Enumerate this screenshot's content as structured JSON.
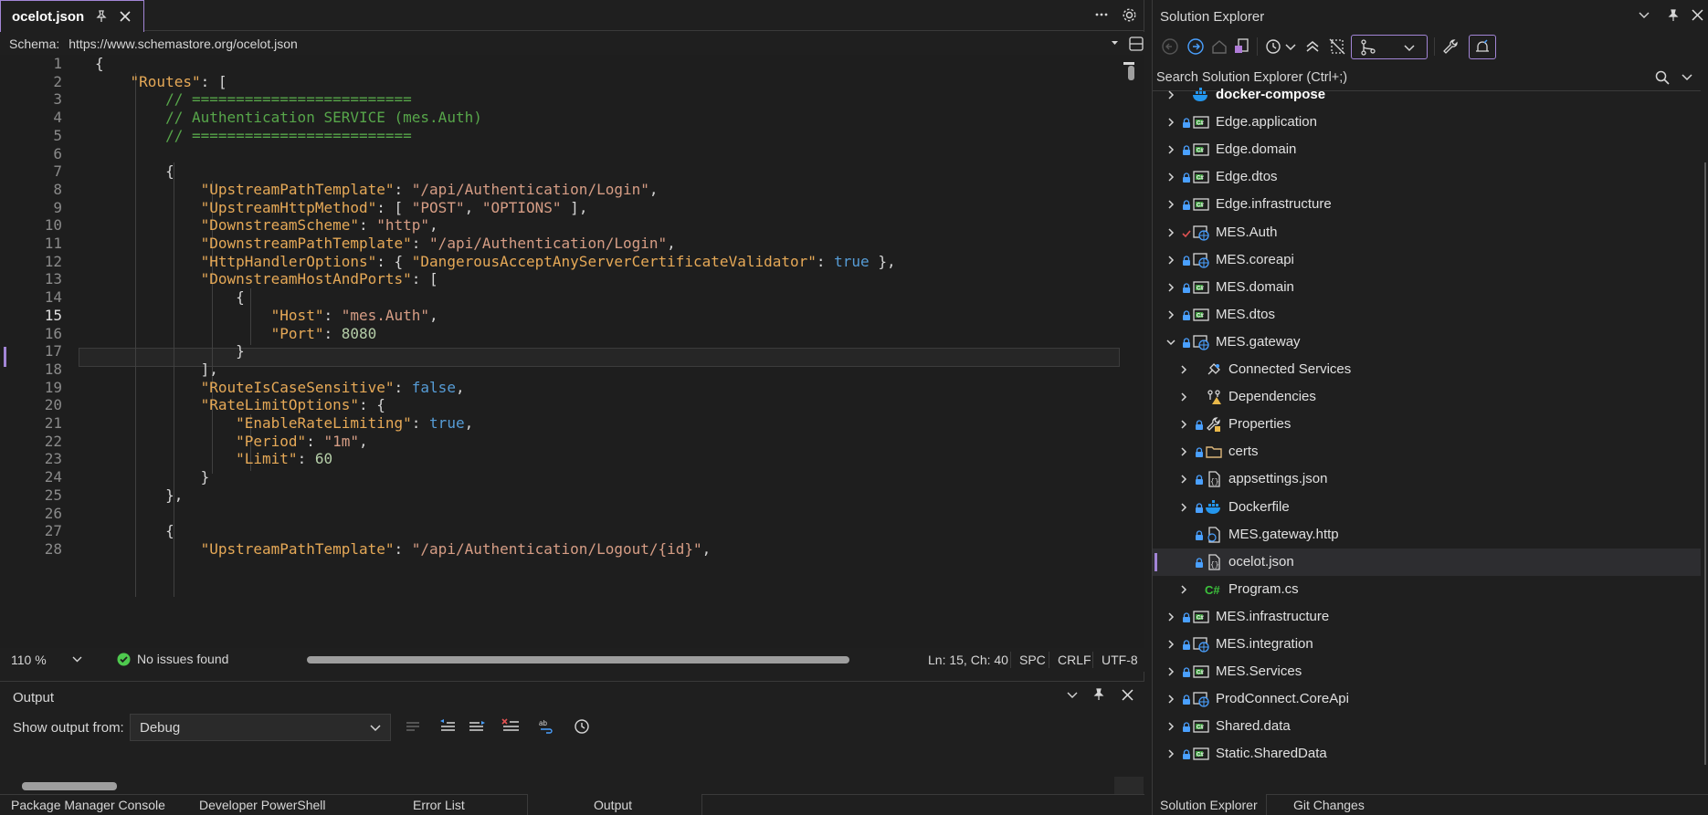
{
  "editor": {
    "tab": {
      "filename": "ocelot.json"
    },
    "schema": {
      "label": "Schema:",
      "value": "https://www.schemastore.org/ocelot.json"
    },
    "lines": [
      {
        "n": "1",
        "tokens": [
          [
            "p",
            "{"
          ]
        ]
      },
      {
        "n": "2",
        "tokens": [
          [
            "p",
            "    "
          ],
          [
            "k",
            "\"Routes\""
          ],
          [
            "p",
            ": ["
          ]
        ]
      },
      {
        "n": "3",
        "tokens": [
          [
            "p",
            "        "
          ],
          [
            "c",
            "// ========================="
          ]
        ]
      },
      {
        "n": "4",
        "tokens": [
          [
            "p",
            "        "
          ],
          [
            "c",
            "// Authentication SERVICE (mes.Auth)"
          ]
        ]
      },
      {
        "n": "5",
        "tokens": [
          [
            "p",
            "        "
          ],
          [
            "c",
            "// ========================="
          ]
        ]
      },
      {
        "n": "6",
        "tokens": []
      },
      {
        "n": "7",
        "tokens": [
          [
            "p",
            "        {"
          ]
        ]
      },
      {
        "n": "8",
        "tokens": [
          [
            "p",
            "            "
          ],
          [
            "k",
            "\"UpstreamPathTemplate\""
          ],
          [
            "p",
            ": "
          ],
          [
            "s",
            "\"/api/Authentication/Login\""
          ],
          [
            "p",
            ","
          ]
        ]
      },
      {
        "n": "9",
        "tokens": [
          [
            "p",
            "            "
          ],
          [
            "k",
            "\"UpstreamHttpMethod\""
          ],
          [
            "p",
            ": [ "
          ],
          [
            "s",
            "\"POST\""
          ],
          [
            "p",
            ", "
          ],
          [
            "s",
            "\"OPTIONS\""
          ],
          [
            "p",
            " ],"
          ]
        ]
      },
      {
        "n": "10",
        "tokens": [
          [
            "p",
            "            "
          ],
          [
            "k",
            "\"DownstreamScheme\""
          ],
          [
            "p",
            ": "
          ],
          [
            "s",
            "\"http\""
          ],
          [
            "p",
            ","
          ]
        ]
      },
      {
        "n": "11",
        "tokens": [
          [
            "p",
            "            "
          ],
          [
            "k",
            "\"DownstreamPathTemplate\""
          ],
          [
            "p",
            ": "
          ],
          [
            "s",
            "\"/api/Authentication/Login\""
          ],
          [
            "p",
            ","
          ]
        ]
      },
      {
        "n": "12",
        "tokens": [
          [
            "p",
            "            "
          ],
          [
            "k",
            "\"HttpHandlerOptions\""
          ],
          [
            "p",
            ": { "
          ],
          [
            "k",
            "\"DangerousAcceptAnyServerCertificateValidator\""
          ],
          [
            "p",
            ": "
          ],
          [
            "b",
            "true"
          ],
          [
            "p",
            " },"
          ]
        ]
      },
      {
        "n": "13",
        "tokens": [
          [
            "p",
            "            "
          ],
          [
            "k",
            "\"DownstreamHostAndPorts\""
          ],
          [
            "p",
            ": ["
          ]
        ]
      },
      {
        "n": "14",
        "tokens": [
          [
            "p",
            "                {"
          ]
        ]
      },
      {
        "n": "15",
        "tokens": [
          [
            "p",
            "                    "
          ],
          [
            "k",
            "\"Host\""
          ],
          [
            "p",
            ": "
          ],
          [
            "s",
            "\"mes.Auth\""
          ],
          [
            "p",
            ","
          ]
        ]
      },
      {
        "n": "16",
        "tokens": [
          [
            "p",
            "                    "
          ],
          [
            "k",
            "\"Port\""
          ],
          [
            "p",
            ": "
          ],
          [
            "n",
            "8080"
          ]
        ]
      },
      {
        "n": "17",
        "tokens": [
          [
            "p",
            "                }"
          ]
        ]
      },
      {
        "n": "18",
        "tokens": [
          [
            "p",
            "            ],"
          ]
        ]
      },
      {
        "n": "19",
        "tokens": [
          [
            "p",
            "            "
          ],
          [
            "k",
            "\"RouteIsCaseSensitive\""
          ],
          [
            "p",
            ": "
          ],
          [
            "b",
            "false"
          ],
          [
            "p",
            ","
          ]
        ]
      },
      {
        "n": "20",
        "tokens": [
          [
            "p",
            "            "
          ],
          [
            "k",
            "\"RateLimitOptions\""
          ],
          [
            "p",
            ": {"
          ]
        ]
      },
      {
        "n": "21",
        "tokens": [
          [
            "p",
            "                "
          ],
          [
            "k",
            "\"EnableRateLimiting\""
          ],
          [
            "p",
            ": "
          ],
          [
            "b",
            "true"
          ],
          [
            "p",
            ","
          ]
        ]
      },
      {
        "n": "22",
        "tokens": [
          [
            "p",
            "                "
          ],
          [
            "k",
            "\"Period\""
          ],
          [
            "p",
            ": "
          ],
          [
            "s",
            "\"1m\""
          ],
          [
            "p",
            ","
          ]
        ]
      },
      {
        "n": "23",
        "tokens": [
          [
            "p",
            "                "
          ],
          [
            "k",
            "\"Limit\""
          ],
          [
            "p",
            ": "
          ],
          [
            "n",
            "60"
          ]
        ]
      },
      {
        "n": "24",
        "tokens": [
          [
            "p",
            "            }"
          ]
        ]
      },
      {
        "n": "25",
        "tokens": [
          [
            "p",
            "        },"
          ]
        ]
      },
      {
        "n": "26",
        "tokens": []
      },
      {
        "n": "27",
        "tokens": [
          [
            "p",
            "        {"
          ]
        ]
      },
      {
        "n": "28",
        "tokens": [
          [
            "p",
            "            "
          ],
          [
            "k",
            "\"UpstreamPathTemplate\""
          ],
          [
            "p",
            ": "
          ],
          [
            "s",
            "\"/api/Authentication/Logout/{id}\""
          ],
          [
            "p",
            ","
          ]
        ]
      }
    ],
    "current_line": "15",
    "status": {
      "zoom": "110 %",
      "issues": "No issues found",
      "position": "Ln: 15, Ch: 40",
      "whitespace": "SPC",
      "line_ending": "CRLF",
      "encoding": "UTF-8"
    }
  },
  "output": {
    "title": "Output",
    "show_from_label": "Show output from:",
    "source": "Debug"
  },
  "bottom_tabs": [
    "Package Manager Console",
    "Developer PowerShell",
    "Error List",
    "Output"
  ],
  "solution_explorer": {
    "title": "Solution Explorer",
    "search_placeholder": "Search Solution Explorer (Ctrl+;)",
    "items": [
      {
        "label": "docker-compose",
        "icon": "docker-icon",
        "bold": true,
        "level": 0,
        "lock": false,
        "chevron": "right"
      },
      {
        "label": "Edge.application",
        "icon": "csharp-project-icon",
        "level": 0,
        "lock": true,
        "chevron": "right"
      },
      {
        "label": "Edge.domain",
        "icon": "csharp-project-icon",
        "level": 0,
        "lock": true,
        "chevron": "right"
      },
      {
        "label": "Edge.dtos",
        "icon": "csharp-project-icon",
        "level": 0,
        "lock": true,
        "chevron": "right"
      },
      {
        "label": "Edge.infrastructure",
        "icon": "csharp-project-icon",
        "level": 0,
        "lock": true,
        "chevron": "right"
      },
      {
        "label": "MES.Auth",
        "icon": "web-project-icon",
        "level": 0,
        "lock": false,
        "check": true,
        "chevron": "right"
      },
      {
        "label": "MES.coreapi",
        "icon": "web-project-icon",
        "level": 0,
        "lock": true,
        "chevron": "right"
      },
      {
        "label": "MES.domain",
        "icon": "csharp-project-icon",
        "level": 0,
        "lock": true,
        "chevron": "right"
      },
      {
        "label": "MES.dtos",
        "icon": "csharp-project-icon",
        "level": 0,
        "lock": true,
        "chevron": "right"
      },
      {
        "label": "MES.gateway",
        "icon": "web-project-icon",
        "level": 0,
        "lock": true,
        "chevron": "down"
      },
      {
        "label": "Connected Services",
        "icon": "connected-services-icon",
        "level": 1,
        "lock": false,
        "chevron": "right"
      },
      {
        "label": "Dependencies",
        "icon": "dependencies-warning-icon",
        "level": 1,
        "lock": false,
        "chevron": "right"
      },
      {
        "label": "Properties",
        "icon": "properties-icon",
        "level": 1,
        "lock": true,
        "chevron": "right"
      },
      {
        "label": "certs",
        "icon": "folder-icon",
        "level": 1,
        "lock": true,
        "chevron": "right"
      },
      {
        "label": "appsettings.json",
        "icon": "json-file-icon",
        "level": 1,
        "lock": true,
        "chevron": "right"
      },
      {
        "label": "Dockerfile",
        "icon": "docker-icon",
        "level": 1,
        "lock": true,
        "chevron": "right"
      },
      {
        "label": "MES.gateway.http",
        "icon": "http-file-icon",
        "level": 1,
        "lock": true,
        "chevron": "none"
      },
      {
        "label": "ocelot.json",
        "icon": "json-file-icon",
        "level": 1,
        "lock": true,
        "chevron": "none",
        "selected": true
      },
      {
        "label": "Program.cs",
        "icon": "csharp-file-icon",
        "level": 1,
        "lock": false,
        "chevron": "right"
      },
      {
        "label": "MES.infrastructure",
        "icon": "csharp-project-icon",
        "level": 0,
        "lock": true,
        "chevron": "right"
      },
      {
        "label": "MES.integration",
        "icon": "web-project-icon",
        "level": 0,
        "lock": true,
        "chevron": "right"
      },
      {
        "label": "MES.Services",
        "icon": "csharp-project-icon",
        "level": 0,
        "lock": true,
        "chevron": "right"
      },
      {
        "label": "ProdConnect.CoreApi",
        "icon": "web-project-icon",
        "level": 0,
        "lock": true,
        "chevron": "right"
      },
      {
        "label": "Shared.data",
        "icon": "csharp-project-icon",
        "level": 0,
        "lock": true,
        "chevron": "right"
      },
      {
        "label": "Static.SharedData",
        "icon": "csharp-project-icon",
        "level": 0,
        "lock": true,
        "chevron": "right"
      }
    ],
    "bottom_tabs": [
      "Solution Explorer",
      "Git Changes"
    ]
  },
  "colors": {
    "accent": "#a285d6",
    "key": "#e6a957",
    "string": "#d69d85",
    "number": "#b5cea8",
    "keyword": "#569cd6",
    "comment": "#57a64a",
    "success": "#4ec94e"
  }
}
